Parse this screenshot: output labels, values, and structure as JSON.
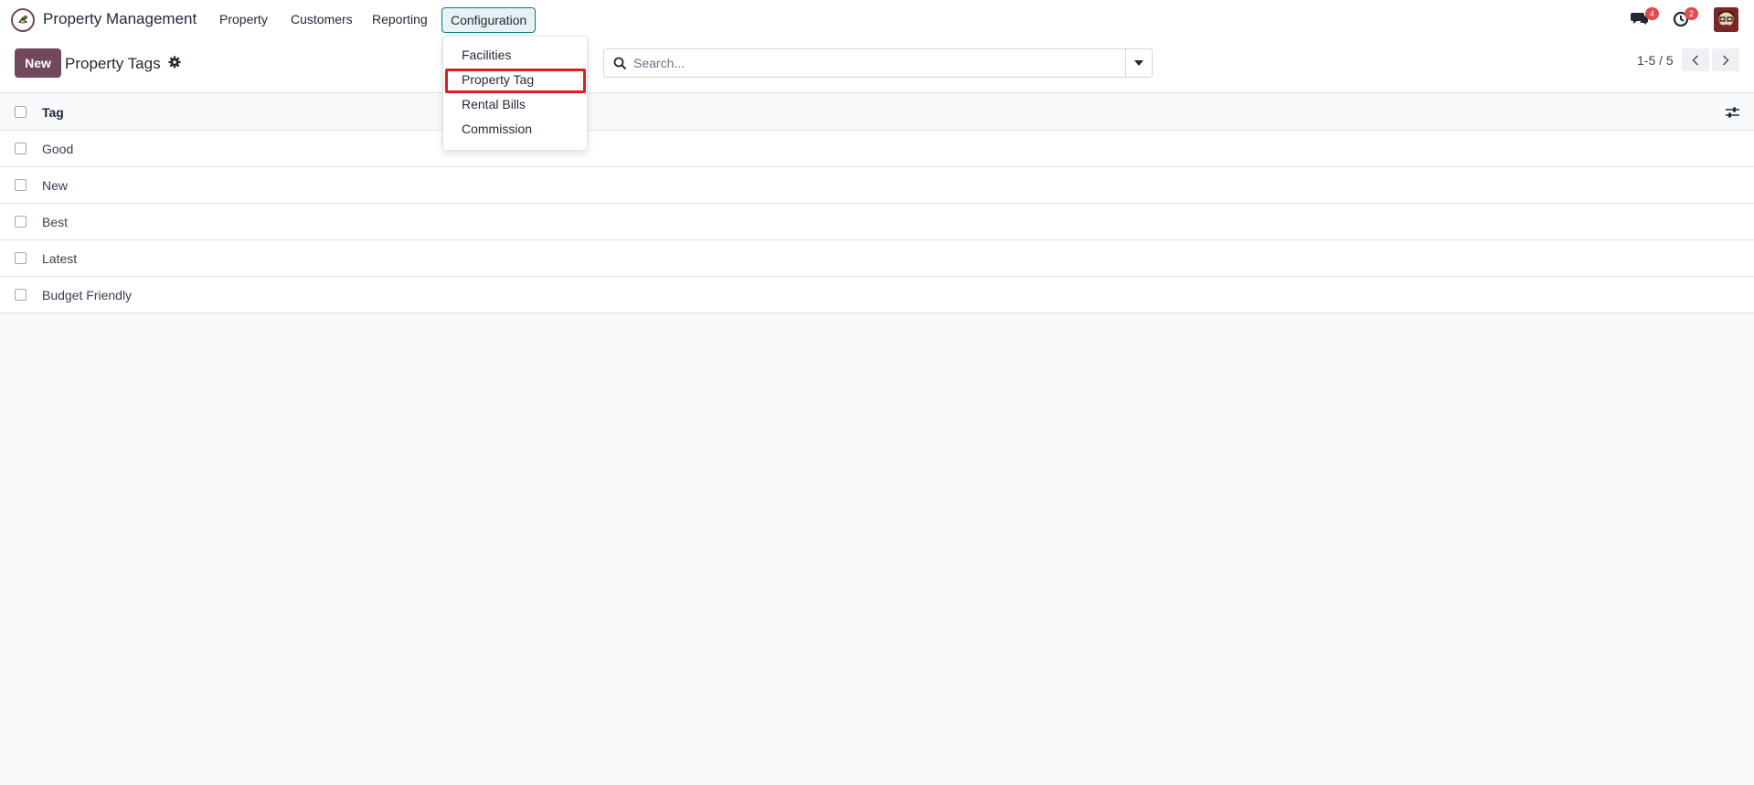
{
  "app": {
    "name": "Property Management"
  },
  "nav": {
    "items": [
      {
        "label": "Property"
      },
      {
        "label": "Customers"
      },
      {
        "label": "Reporting"
      },
      {
        "label": "Configuration",
        "active": true
      }
    ]
  },
  "systray": {
    "messages_icon": "chat-icon",
    "messages_count": "4",
    "activity_icon": "clock-icon",
    "activity_count": "2"
  },
  "control": {
    "new_label": "New",
    "title": "Property Tags"
  },
  "search": {
    "placeholder": "Search..."
  },
  "pager": {
    "text": "1-5 / 5"
  },
  "list": {
    "header": "Tag",
    "rows": [
      "Good",
      "New",
      "Best",
      "Latest",
      "Budget Friendly"
    ]
  },
  "dropdown": {
    "items": [
      "Facilities",
      "Property Tag",
      "Rental Bills",
      "Commission"
    ],
    "highlighted": "Property Tag"
  },
  "colors": {
    "brand": "#71485e",
    "active_nav": "#017e84",
    "badge": "#e04b4b",
    "highlight": "#e01b1b"
  }
}
